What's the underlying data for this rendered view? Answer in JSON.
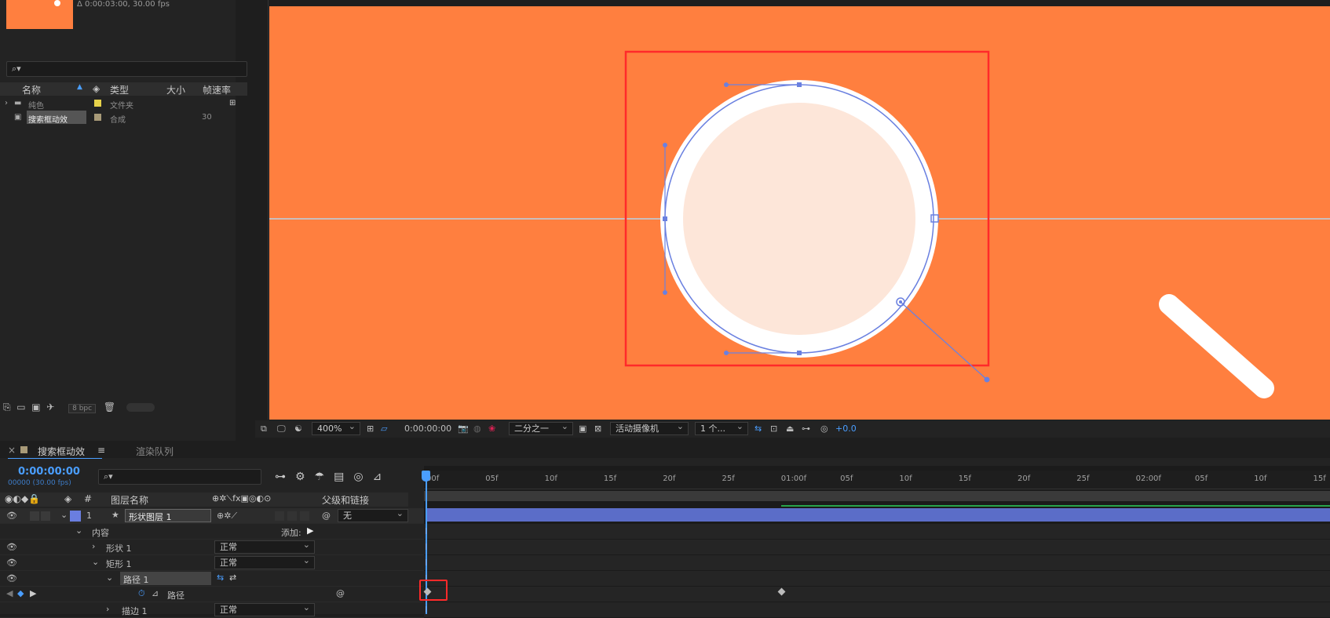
{
  "project": {
    "info": "Δ 0:00:03:00, 30.00 fps",
    "search_icon": "search-icon",
    "columns": {
      "name": "名称",
      "type": "类型",
      "size": "大小",
      "fps": "帧速率"
    },
    "items": [
      {
        "name": "纯色",
        "type": "文件夹",
        "fps": "",
        "label_color": "#e6d24a",
        "icon": "folder-icon"
      },
      {
        "name": "搜索框动效",
        "type": "合成",
        "fps": "30",
        "label_color": "#a89a78",
        "icon": "composition-icon"
      }
    ],
    "footer": {
      "bpc": "8 bpc"
    }
  },
  "viewer": {
    "background": "#ff7f3f",
    "zoom": "400%",
    "timecode": "0:00:00:00",
    "resolution": "二分之一",
    "camera": "活动摄像机",
    "views": "1 个...",
    "exposure": "+0.0"
  },
  "timeline": {
    "comp_tab": "搜索框动效",
    "render_tab": "渲染队列",
    "timecode": "0:00:00:00",
    "timecode_sub": "00000 (30.00 fps)",
    "columns": {
      "num": "#",
      "layer_name": "图层名称",
      "parent": "父级和链接"
    },
    "ruler": [
      "00f",
      "05f",
      "10f",
      "15f",
      "20f",
      "25f",
      "01:00f",
      "05f",
      "10f",
      "15f",
      "20f",
      "25f",
      "02:00f",
      "05f",
      "10f",
      "15f"
    ],
    "layer": {
      "num": "1",
      "name": "形状图层 1",
      "parent": "无"
    },
    "props": {
      "contents": "内容",
      "add": "添加:",
      "shape1": "形状 1",
      "shape1_mode": "正常",
      "rect1": "矩形 1",
      "rect1_mode": "正常",
      "path1": "路径 1",
      "path": "路径",
      "stroke1": "描边 1",
      "stroke1_mode": "正常"
    },
    "layer_bar_color": "#5b6dc8",
    "accent": "#4a9eff"
  }
}
